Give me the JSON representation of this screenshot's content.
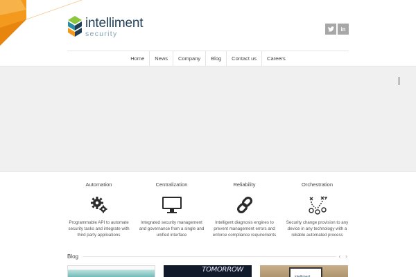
{
  "brand": {
    "name": "intelliment",
    "sub": "security"
  },
  "social": [
    {
      "icon": "twitter-icon",
      "glyph": "t"
    },
    {
      "icon": "linkedin-icon",
      "glyph": "in"
    }
  ],
  "nav": [
    {
      "label": "Home",
      "active": true
    },
    {
      "label": "News"
    },
    {
      "label": "Company"
    },
    {
      "label": "Blog"
    },
    {
      "label": "Contact us"
    },
    {
      "label": "Careers"
    }
  ],
  "features": [
    {
      "title": "Automation",
      "icon": "gears-icon",
      "desc": "Programmable API to automate security tasks and integrate with third party applications"
    },
    {
      "title": "Centralization",
      "icon": "monitor-icon",
      "desc": "Integrated security management and governance from a single and unified interface"
    },
    {
      "title": "Reliability",
      "icon": "chain-link-icon",
      "desc": "Intelligent diagnosis engines to prevent management errors and enforce compliance requirements"
    },
    {
      "title": "Orchestration",
      "icon": "strategy-play-icon",
      "desc": "Security change provision to any device in any technology with a reliable automated process"
    }
  ],
  "blog": {
    "title": "Blog",
    "arrows": "‹ ›",
    "cards": [
      {
        "text": ""
      },
      {
        "text": "TOMORROW"
      },
      {
        "text": "intelliment"
      }
    ]
  },
  "colors": {
    "accent": "#4a9fb0",
    "brand_dark": "#1f3d55",
    "orange": "#f39a1e"
  }
}
